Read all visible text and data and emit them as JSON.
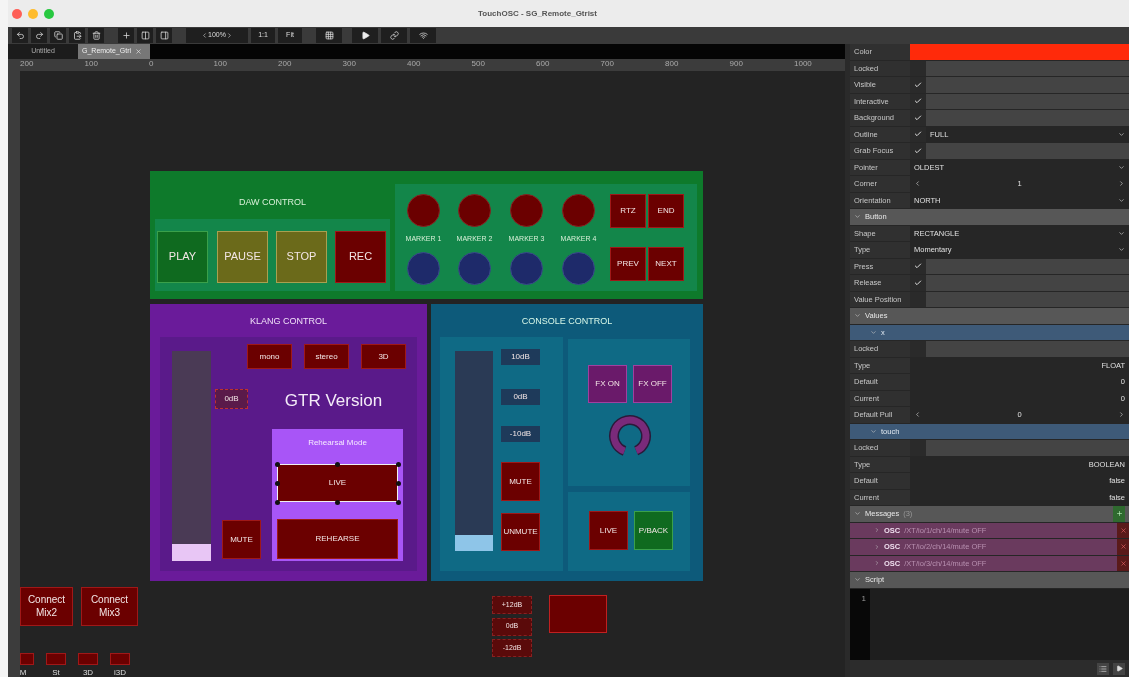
{
  "window": {
    "title": "TouchOSC - SG_Remote_Gtrist"
  },
  "toolbar": {
    "zoom": "100%",
    "actual_size": "1:1",
    "fit": "Fit"
  },
  "tabs": [
    {
      "label": "Untitled",
      "selected": false
    },
    {
      "label": "G_Remote_Gtri",
      "selected": true
    }
  ],
  "ruler": [
    "200",
    "100",
    "0",
    "100",
    "200",
    "300",
    "400",
    "500",
    "600",
    "700",
    "800",
    "900",
    "1000"
  ],
  "canvas": {
    "daw": {
      "title": "DAW CONTROL",
      "transport": [
        {
          "label": "PLAY",
          "color": "#0f6a1f"
        },
        {
          "label": "PAUSE",
          "color": "#6b6a1a"
        },
        {
          "label": "STOP",
          "color": "#6b6a1a"
        },
        {
          "label": "REC",
          "color": "#6b0000"
        }
      ],
      "markers": [
        "MARKER 1",
        "MARKER 2",
        "MARKER 3",
        "MARKER 4"
      ],
      "navigation": [
        "RTZ",
        "END",
        "PREV",
        "NEXT"
      ]
    },
    "klang": {
      "title": "KLANG CONTROL",
      "fader": {
        "level": 0.08
      },
      "modes": [
        "mono",
        "stereo",
        "3D"
      ],
      "gain_label": "0dB",
      "version": "GTR Version",
      "rehearsal": {
        "title": "Rehearsal Mode",
        "buttons": [
          {
            "label": "LIVE",
            "selected": true
          },
          {
            "label": "REHEARSE",
            "selected": false
          }
        ]
      },
      "mute": "MUTE"
    },
    "console": {
      "title": "CONSOLE CONTROL",
      "fader": {
        "level": 0.08
      },
      "scale": [
        "10dB",
        "0dB",
        "-10dB"
      ],
      "buttons": [
        "MUTE",
        "UNMUTE"
      ],
      "fx": [
        "FX ON",
        "FX OFF"
      ],
      "source": [
        {
          "label": "LIVE",
          "color": "#6b0000"
        },
        {
          "label": "P/BACK",
          "color": "#0f6a1f"
        }
      ]
    },
    "connect": [
      "Connect Mix2",
      "Connect Mix3"
    ],
    "mix_modes": [
      "M",
      "St",
      "3D",
      "i3D"
    ],
    "trim": [
      "+12dB",
      "0dB",
      "-12dB"
    ]
  },
  "inspector": {
    "rows": [
      {
        "kind": "color",
        "label": "Color",
        "color": "#ff2a0a"
      },
      {
        "kind": "check",
        "label": "Locked",
        "checked": false
      },
      {
        "kind": "check",
        "label": "Visible",
        "checked": true
      },
      {
        "kind": "check",
        "label": "Interactive",
        "checked": true
      },
      {
        "kind": "check",
        "label": "Background",
        "checked": true
      },
      {
        "kind": "check_dropdown",
        "label": "Outline",
        "checked": true,
        "value": "FULL"
      },
      {
        "kind": "check",
        "label": "Grab Focus",
        "checked": true
      },
      {
        "kind": "dropdown",
        "label": "Pointer",
        "value": "OLDEST"
      },
      {
        "kind": "stepper",
        "label": "Corner",
        "value": "1"
      },
      {
        "kind": "dropdown",
        "label": "Orientation",
        "value": "NORTH"
      },
      {
        "kind": "section",
        "label": "Button"
      },
      {
        "kind": "dropdown",
        "label": "Shape",
        "value": "RECTANGLE"
      },
      {
        "kind": "dropdown",
        "label": "Type",
        "value": "Momentary"
      },
      {
        "kind": "check",
        "label": "Press",
        "checked": true
      },
      {
        "kind": "check",
        "label": "Release",
        "checked": true
      },
      {
        "kind": "check",
        "label": "Value Position",
        "checked": false
      },
      {
        "kind": "section",
        "label": "Values"
      },
      {
        "kind": "subsection",
        "label": "x"
      },
      {
        "kind": "check",
        "label": "Locked",
        "checked": false
      },
      {
        "kind": "value",
        "label": "Type",
        "value": "FLOAT"
      },
      {
        "kind": "value",
        "label": "Default",
        "value": "0"
      },
      {
        "kind": "value",
        "label": "Current",
        "value": "0"
      },
      {
        "kind": "stepper",
        "label": "Default Pull",
        "value": "0"
      },
      {
        "kind": "subsection",
        "label": "touch"
      },
      {
        "kind": "check",
        "label": "Locked",
        "checked": false
      },
      {
        "kind": "value",
        "label": "Type",
        "value": "BOOLEAN"
      },
      {
        "kind": "value",
        "label": "Default",
        "value": "false"
      },
      {
        "kind": "value",
        "label": "Current",
        "value": "false"
      },
      {
        "kind": "section",
        "label": "Messages",
        "count": "(3)"
      },
      {
        "kind": "message",
        "type": "OSC",
        "path": "/XT/io/1/ch/14/mute OFF"
      },
      {
        "kind": "message",
        "type": "OSC",
        "path": "/XT/io/2/ch/14/mute OFF"
      },
      {
        "kind": "message",
        "type": "OSC",
        "path": "/XT/io/3/ch/14/mute OFF"
      },
      {
        "kind": "section",
        "label": "Script"
      }
    ]
  },
  "script": {
    "lines": [
      "1"
    ]
  }
}
